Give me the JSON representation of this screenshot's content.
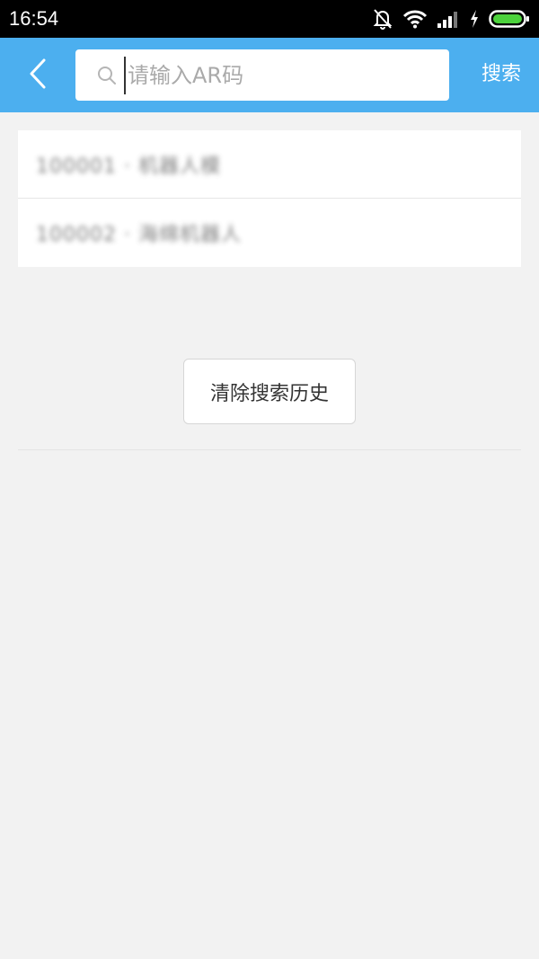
{
  "status_bar": {
    "time": "16:54"
  },
  "icons": {
    "mute": "bell-off-icon",
    "wifi": "wifi-icon",
    "signal": "signal-icon",
    "charging": "charging-bolt-icon",
    "battery": "battery-icon",
    "back": "chevron-left-icon",
    "search": "search-icon"
  },
  "header": {
    "search_placeholder": "请输入AR码",
    "search_value": "",
    "search_label": "搜索"
  },
  "history": {
    "items": [
      {
        "label": "100001 · 机器人模"
      },
      {
        "label": "100002 · 海绵机器人"
      }
    ]
  },
  "actions": {
    "clear_history_label": "清除搜索历史"
  },
  "colors": {
    "app_bar": "#4cafef",
    "background": "#f2f2f2",
    "battery": "#4cd23c"
  }
}
